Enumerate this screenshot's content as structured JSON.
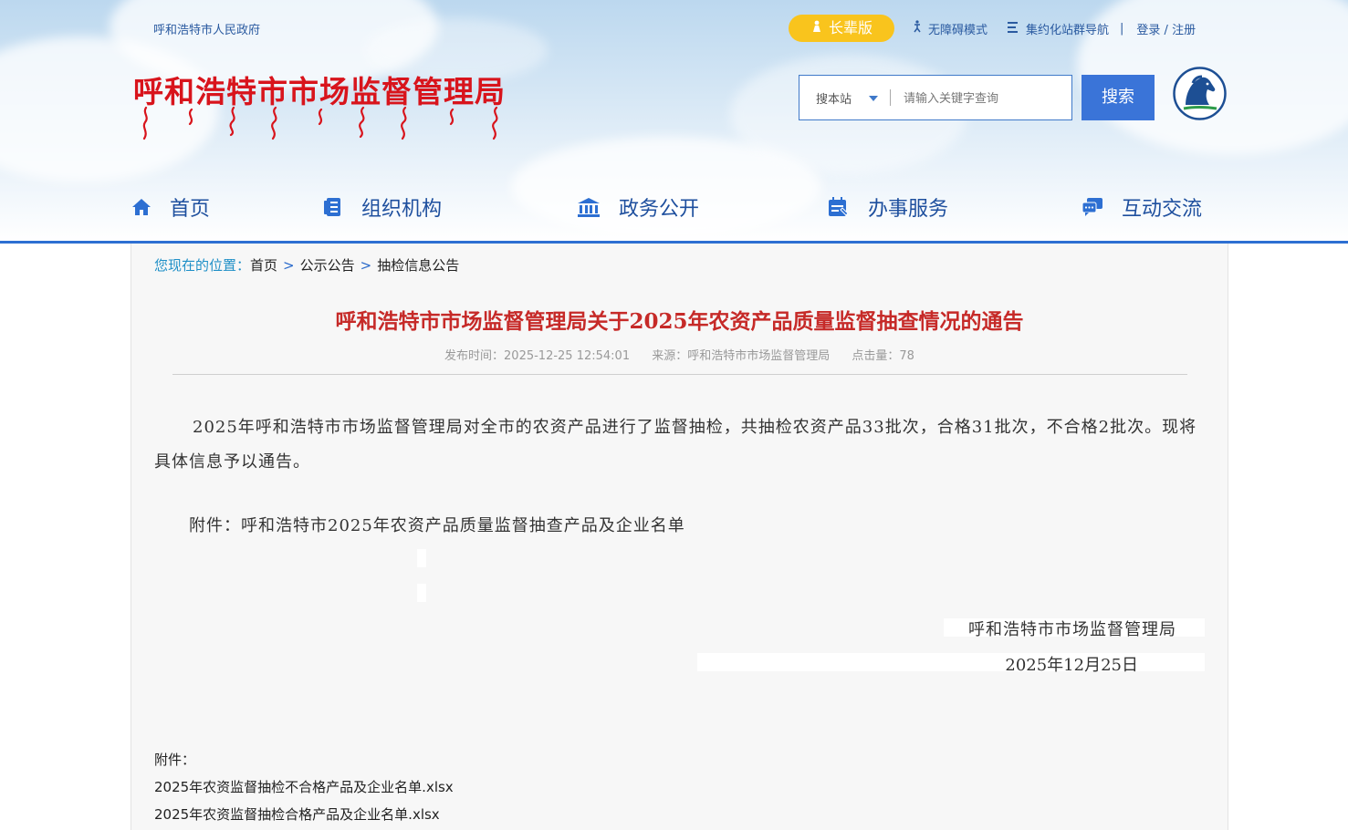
{
  "header": {
    "gov_link": "呼和浩特市人民政府",
    "elder_label": "长辈版",
    "accessibility_label": "无障碍模式",
    "site_nav_label": "集约化站群导航",
    "login_label": "登录 / 注册",
    "site_title": "呼和浩特市市场监督管理局",
    "search_scope": "搜本站",
    "search_placeholder": "请输入关键字查询",
    "search_button": "搜索"
  },
  "nav": [
    {
      "label": "首页",
      "icon": "home-icon"
    },
    {
      "label": "组织机构",
      "icon": "organization-icon"
    },
    {
      "label": "政务公开",
      "icon": "government-building-icon"
    },
    {
      "label": "办事服务",
      "icon": "service-calendar-icon"
    },
    {
      "label": "互动交流",
      "icon": "chat-icon"
    }
  ],
  "breadcrumb": {
    "lead": "您现在的位置：",
    "items": [
      "首页",
      "公示公告",
      "抽检信息公告"
    ],
    "separator": ">"
  },
  "article": {
    "title": "呼和浩特市市场监督管理局关于2025年农资产品质量监督抽查情况的通告",
    "publish_time": "发布时间：2025-12-25 12:54:01",
    "source": "来源：呼和浩特市市场监督管理局",
    "clicks": "点击量：78",
    "paragraph": "2025年呼和浩特市市场监督管理局对全市的农资产品进行了监督抽检，共抽检农资产品33批次，合格31批次，不合格2批次。现将具体信息予以通告。",
    "attachment_line": "附件：呼和浩特市2025年农资产品质量监督抽查产品及企业名单",
    "signature": "呼和浩特市市场监督管理局",
    "date": "2025年12月25日",
    "attachments_label": "附件：",
    "files": [
      "2025年农资监督抽检不合格产品及企业名单.xlsx",
      "2025年农资监督抽检合格产品及企业名单.xlsx"
    ]
  },
  "colors": {
    "brand_blue": "#2d6fd2",
    "title_red": "#c62a28",
    "elder_yellow": "#f9c41d"
  }
}
